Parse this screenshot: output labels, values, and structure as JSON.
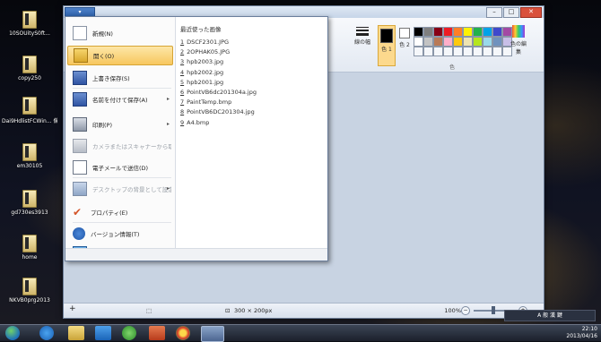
{
  "desktop": {
    "icons": [
      {
        "label": "10SOUityS0ft..."
      },
      {
        "label": "copy250"
      },
      {
        "label": "Dai9HdlistFCWin... 偏数2013"
      },
      {
        "label": "em30105"
      },
      {
        "label": "gd730es3913"
      },
      {
        "label": "home"
      },
      {
        "label": "NKVB0prg2013"
      }
    ]
  },
  "paint": {
    "ribbon": {
      "size_label": "線の幅",
      "color1_label": "色 1",
      "color2_label": "色 2",
      "edit_colors_label": "色の編集",
      "colors_group_label": "色",
      "palette": [
        "#000000",
        "#7f7f7f",
        "#880015",
        "#ed1c24",
        "#ff7f27",
        "#fff200",
        "#22b14c",
        "#00a2e8",
        "#3f48cc",
        "#a349a4",
        "#ffffff",
        "#c3c3c3",
        "#b97a57",
        "#ffaec9",
        "#ffc90e",
        "#efe4b0",
        "#b5e61d",
        "#99d9ea",
        "#7092be",
        "#c8bfe7"
      ]
    },
    "statusbar": {
      "dimensions": "300 × 200px",
      "zoom": "100%"
    }
  },
  "file_menu": {
    "tab_label": "▾",
    "items": [
      {
        "label": "新規(N)",
        "has_arrow": false,
        "disabled": false,
        "icon": "new-document-icon"
      },
      {
        "label": "開く(O)",
        "has_arrow": false,
        "disabled": false,
        "icon": "open-folder-icon",
        "active": true
      },
      {
        "label": "上書き保存(S)",
        "has_arrow": false,
        "disabled": false,
        "icon": "save-icon"
      },
      {
        "label": "名前を付けて保存(A)",
        "has_arrow": true,
        "disabled": false,
        "icon": "save-as-icon"
      },
      {
        "label": "印刷(P)",
        "has_arrow": true,
        "disabled": false,
        "icon": "print-icon"
      },
      {
        "label": "カメラまたはスキャナーから取り込み(M)",
        "has_arrow": false,
        "disabled": true,
        "icon": "scanner-icon"
      },
      {
        "label": "電子メールで送信(D)",
        "has_arrow": false,
        "disabled": false,
        "icon": "email-icon"
      },
      {
        "label": "デスクトップの背景として設定(B)",
        "has_arrow": true,
        "disabled": true,
        "icon": "desktop-background-icon"
      },
      {
        "label": "プロパティ(E)",
        "has_arrow": false,
        "disabled": false,
        "icon": "checkmark-icon"
      },
      {
        "label": "バージョン情報(T)",
        "has_arrow": false,
        "disabled": false,
        "icon": "info-icon"
      },
      {
        "label": "終了(X)",
        "has_arrow": false,
        "disabled": false,
        "icon": "exit-icon"
      }
    ],
    "recent_header": "最近使った画像",
    "recent": [
      {
        "n": "1",
        "name": "DSCF2301.JPG"
      },
      {
        "n": "2",
        "name": "2OPHAK05.JPG"
      },
      {
        "n": "3",
        "name": "hpb2003.jpg"
      },
      {
        "n": "4",
        "name": "hpb2002.jpg"
      },
      {
        "n": "5",
        "name": "hpb2001.jpg"
      },
      {
        "n": "6",
        "name": "PointVB6dc201304a.jpg"
      },
      {
        "n": "7",
        "name": "PaintTemp.bmp"
      },
      {
        "n": "8",
        "name": "PointVB6DC201304.jpg"
      },
      {
        "n": "9",
        "name": "A4.bmp"
      }
    ]
  },
  "taskbar": {
    "time": "22:10",
    "date": "2013/04/16",
    "ime": "A 般 漢 鍵"
  }
}
